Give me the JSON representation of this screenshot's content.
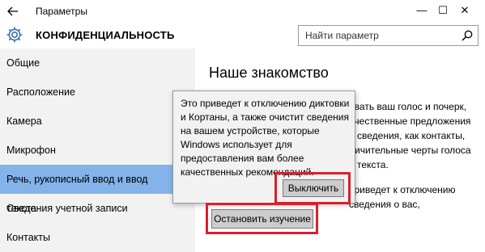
{
  "window": {
    "title": "Параметры",
    "back_icon": "arrow-left-icon",
    "minimize_glyph": "—",
    "maximize_glyph": "☐",
    "close_glyph": "✕"
  },
  "header": {
    "title": "КОНФИДЕНЦИАЛЬНОСТЬ",
    "icon": "gear-icon",
    "search_placeholder": "Найти параметр",
    "search_icon": "search-icon"
  },
  "sidebar": {
    "active_color": "#83b3e8",
    "items": [
      {
        "label": "Общие"
      },
      {
        "label": "Расположение"
      },
      {
        "label": "Камера"
      },
      {
        "label": "Микрофон"
      },
      {
        "label": "Речь, рукописный ввод и ввод текста"
      },
      {
        "label": "Сведения учетной записи"
      },
      {
        "label": "Контакты"
      }
    ],
    "active_index": 4
  },
  "content": {
    "title": "Наше знакомство",
    "visible_lines": [
      "авать ваш голос и почерк,",
      "ачественные предложения",
      "е сведения, как контакты,",
      "личительные черты голоса",
      "а текста.",
      "приведет к отключению",
      "сведения о вас,"
    ]
  },
  "dialog": {
    "lines": [
      "Это приведет к отключению диктовки",
      "и Кортаны, а также очистит сведения",
      "на вашем устройстве, которые",
      "Windows использует для",
      "предоставления вам более",
      "качественных рекомендаций."
    ],
    "confirm_label": "Выключить"
  },
  "stop_button": {
    "label": "Остановить изучение"
  },
  "highlight_color": "#d8202e"
}
